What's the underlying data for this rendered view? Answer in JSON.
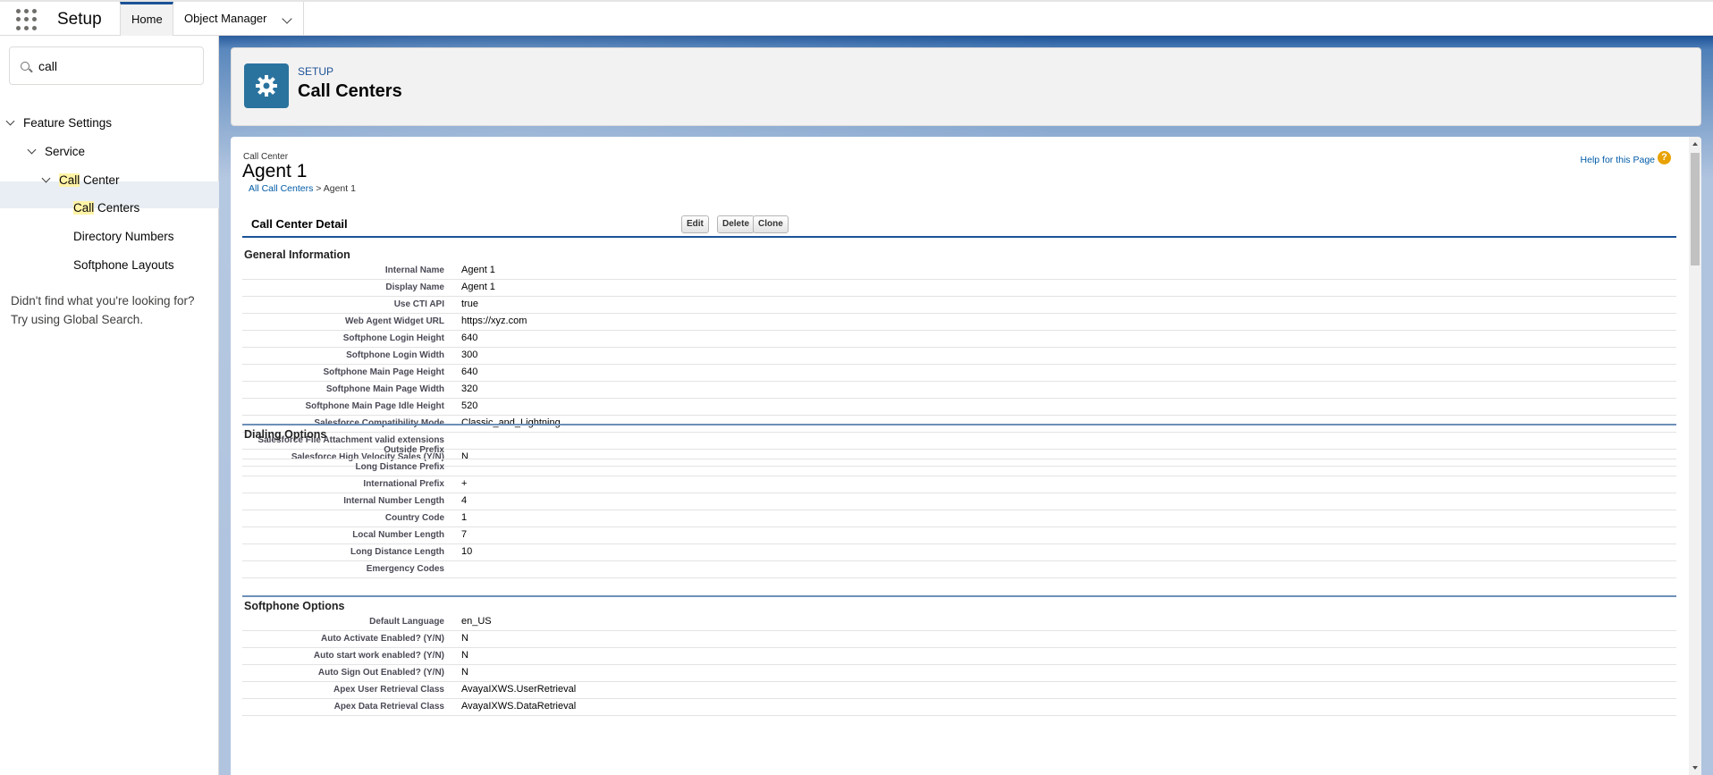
{
  "topbar": {
    "app_name": "Setup",
    "tabs": [
      {
        "label": "Home"
      },
      {
        "label": "Object Manager"
      }
    ]
  },
  "sidebar": {
    "search_value": "call",
    "tree": {
      "feature_settings": "Feature Settings",
      "service": "Service",
      "call_center_hl": "Call",
      "call_center_rest": " Center",
      "call_centers_hl": "Call",
      "call_centers_rest": " Centers",
      "directory_numbers": "Directory Numbers",
      "softphone_layouts": "Softphone Layouts"
    },
    "not_found_line1": "Didn't find what you're looking for?",
    "not_found_line2": "Try using Global Search."
  },
  "header": {
    "breadcrumb": "SETUP",
    "title": "Call Centers"
  },
  "detail": {
    "type_label": "Call Center",
    "record_name": "Agent 1",
    "bc_link": "All Call Centers",
    "bc_sep": " > ",
    "bc_current": "Agent 1",
    "help_link": "Help for this Page",
    "help_icon": "?",
    "block_title": "Call Center Detail",
    "buttons": {
      "edit": "Edit",
      "delete": "Delete",
      "clone": "Clone"
    }
  },
  "sections": {
    "general": {
      "title": "General Information",
      "rows": [
        {
          "label": "Internal Name",
          "value": "Agent 1"
        },
        {
          "label": "Display Name",
          "value": "Agent 1"
        },
        {
          "label": "Use CTI API",
          "value": "true"
        },
        {
          "label": "Web Agent Widget URL",
          "value": "https://xyz.com"
        },
        {
          "label": "Softphone Login Height",
          "value": "640"
        },
        {
          "label": "Softphone Login Width",
          "value": "300"
        },
        {
          "label": "Softphone Main Page Height",
          "value": "640"
        },
        {
          "label": "Softphone Main Page Width",
          "value": "320"
        },
        {
          "label": "Softphone Main Page Idle Height",
          "value": "520"
        },
        {
          "label": "Salesforce Compatibility Mode",
          "value": "Classic_and_Lightning"
        },
        {
          "label": "Salesforce File Attachment valid extensions",
          "value": ""
        },
        {
          "label": "Salesforce High Velocity Sales (Y/N)",
          "value": "N"
        }
      ]
    },
    "dialing": {
      "title": "Dialing Options",
      "rows": [
        {
          "label": "Outside Prefix",
          "value": ""
        },
        {
          "label": "Long Distance Prefix",
          "value": ""
        },
        {
          "label": "International Prefix",
          "value": "+"
        },
        {
          "label": "Internal Number Length",
          "value": "4"
        },
        {
          "label": "Country Code",
          "value": "1"
        },
        {
          "label": "Local Number Length",
          "value": "7"
        },
        {
          "label": "Long Distance Length",
          "value": "10"
        },
        {
          "label": "Emergency Codes",
          "value": ""
        }
      ]
    },
    "softphone": {
      "title": "Softphone Options",
      "rows": [
        {
          "label": "Default Language",
          "value": "en_US"
        },
        {
          "label": "Auto Activate Enabled? (Y/N)",
          "value": "N"
        },
        {
          "label": "Auto start work enabled? (Y/N)",
          "value": "N"
        },
        {
          "label": "Auto Sign Out Enabled? (Y/N)",
          "value": "N"
        },
        {
          "label": "Apex User Retrieval Class",
          "value": "AvayaIXWS.UserRetrieval"
        },
        {
          "label": "Apex Data Retrieval Class",
          "value": "AvayaIXWS.DataRetrieval"
        }
      ]
    }
  }
}
